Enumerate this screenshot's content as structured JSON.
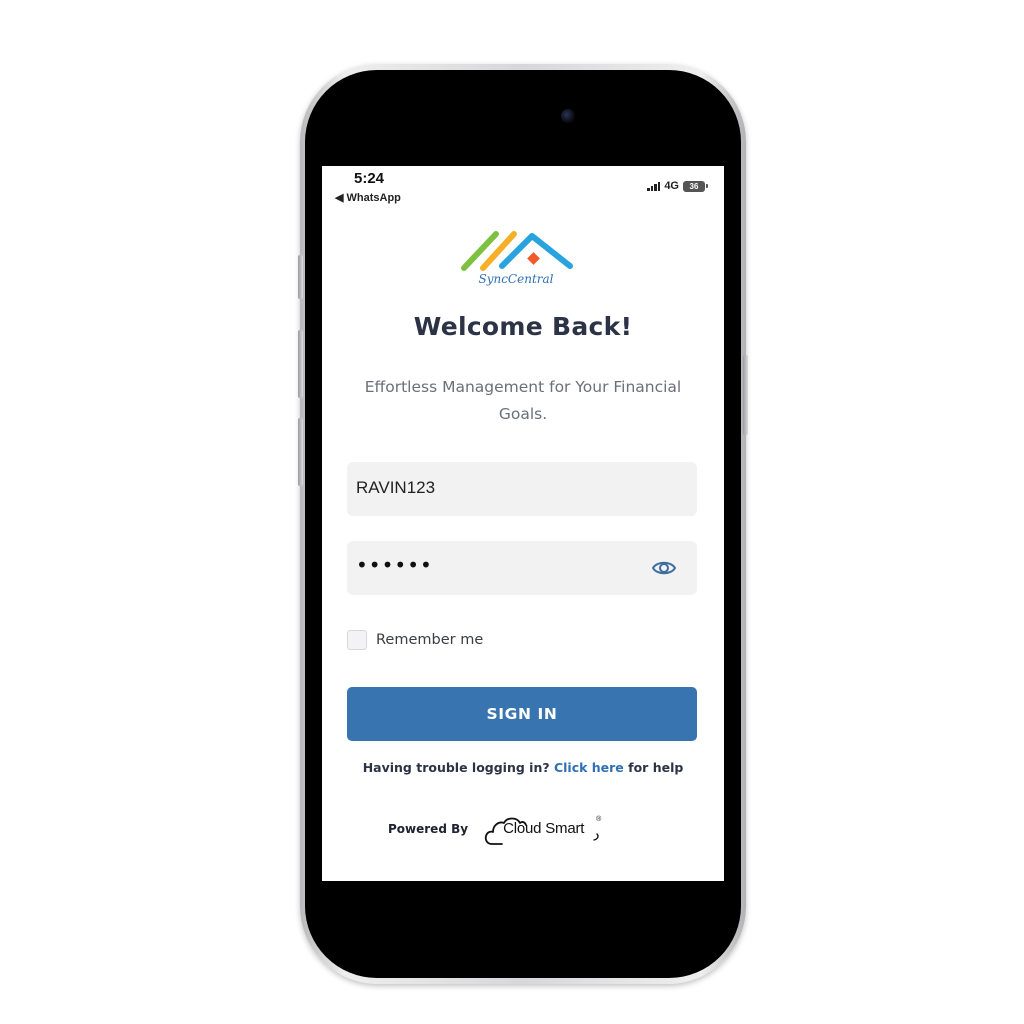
{
  "status_bar": {
    "time": "5:24",
    "back_app": "◀ WhatsApp",
    "network": "4G",
    "battery": "36"
  },
  "logo": {
    "text": "SyncCentral",
    "colors": [
      "#7cc142",
      "#f5b027",
      "#29a3dd",
      "#f15a29"
    ]
  },
  "login": {
    "title": "Welcome Back!",
    "subtitle_line1": "Effortless Management for Your Financial",
    "subtitle_line2": "Goals.",
    "username_value": "RAVIN123",
    "password_value": "••••••",
    "remember_label": "Remember me",
    "remember_checked": false,
    "sign_in_label": "SIGN IN",
    "help_prefix": "Having trouble logging in?",
    "help_link": "Click here",
    "help_suffix": "for help"
  },
  "footer": {
    "powered_by": "Powered By",
    "brand": "Cloud Smart",
    "brand_mark": "®"
  },
  "colors": {
    "primary_button": "#3774b0",
    "link": "#2f6fb3",
    "title": "#2d3347",
    "input_bg": "#f2f2f3"
  },
  "icons": [
    "signal-bars-icon",
    "battery-icon",
    "eye-icon",
    "cloud-icon"
  ]
}
